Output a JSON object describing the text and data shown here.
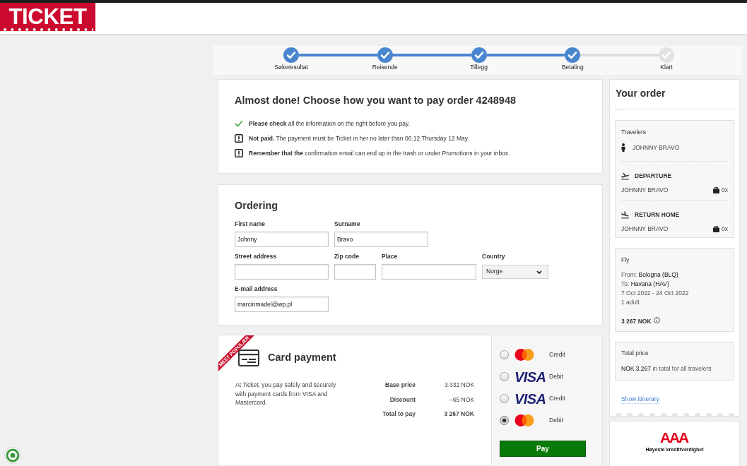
{
  "header": {
    "logo": "TICKET"
  },
  "steps": [
    {
      "label": "Søkeresultat",
      "done": true
    },
    {
      "label": "Reisende",
      "done": true
    },
    {
      "label": "Tillegg",
      "done": true
    },
    {
      "label": "Betaling",
      "done": true
    },
    {
      "label": "Klart",
      "done": false
    }
  ],
  "summary": {
    "title": "Almost done! Choose how you want to pay order 4248948",
    "notices": [
      {
        "kind": "check",
        "text": "**Please check** all the information on the right before you pay."
      },
      {
        "kind": "warning",
        "text": "**Not paid.** The payment must be Ticket in her no later than 00.12 Thursday 12 May."
      },
      {
        "kind": "warning",
        "text": "**Remember that the** confirmation email can end up in the trash or under Promotions in your inbox."
      }
    ]
  },
  "ordering": {
    "title": "Ordering",
    "rows": [
      [
        {
          "kind": "text",
          "label": "First name",
          "value": "Johnny"
        },
        {
          "kind": "text",
          "label": "Surname",
          "value": "Bravo"
        }
      ],
      [
        {
          "kind": "text",
          "label": "Street address"
        },
        {
          "kind": "text",
          "label": "Zip code"
        },
        {
          "kind": "text",
          "label": "Place"
        },
        {
          "kind": "select",
          "label": "Country",
          "value": "Norge"
        }
      ],
      [
        {
          "kind": "text",
          "label": "E-mail address",
          "value": "marcinmadel@wp.pl"
        }
      ]
    ]
  },
  "card_payment": {
    "ribbon": "MEST POPULÆR",
    "title": "Card payment",
    "description": "At Ticket, you pay safely and securely with payment cards from VISA and Mastercard.",
    "prices": [
      {
        "kind": "line",
        "label": "Base price",
        "value": "3 332 NOK"
      },
      {
        "kind": "line",
        "label": "Discount",
        "value": "−65 NOK"
      },
      {
        "kind": "total",
        "label": "Total to pay",
        "value": "3 267 NOK"
      }
    ],
    "cards": [
      {
        "kind": "mastercard",
        "type": "Credit",
        "selected": false
      },
      {
        "kind": "visa",
        "logo": "VISA",
        "type": "Debit",
        "selected": false
      },
      {
        "kind": "visa",
        "logo": "VISA",
        "type": "Credit",
        "selected": false
      },
      {
        "kind": "mastercard",
        "type": "Debit",
        "selected": true
      }
    ],
    "pay_button": "Pay"
  },
  "order": {
    "title": "Your order",
    "travelers": {
      "title": "Travelers",
      "names": [
        "JOHNNY BRAVO"
      ]
    },
    "legs": [
      {
        "kind": "departure",
        "title": "DEPARTURE",
        "passenger": "JOHNNY BRAVO",
        "bags": "0x"
      },
      {
        "kind": "return",
        "title": "RETURN HOME",
        "passenger": "JOHNNY BRAVO",
        "bags": "0x"
      }
    ],
    "flight": {
      "title": "Fly",
      "lines": [
        "From: **Bologna (BLQ)**",
        "To: **Havana (HAV)**",
        "7 Oct 2022 - 24 Oct 2022",
        "1 adult"
      ],
      "price": "3 267 NOK"
    },
    "total": {
      "title": "Total price",
      "text": "**NOK 3,267** in total for all travelers"
    },
    "itinerary_link": "Show itinerary"
  },
  "rating_badge": {
    "logo": "AAA",
    "caption": "Høyeste kredittverdighet"
  }
}
